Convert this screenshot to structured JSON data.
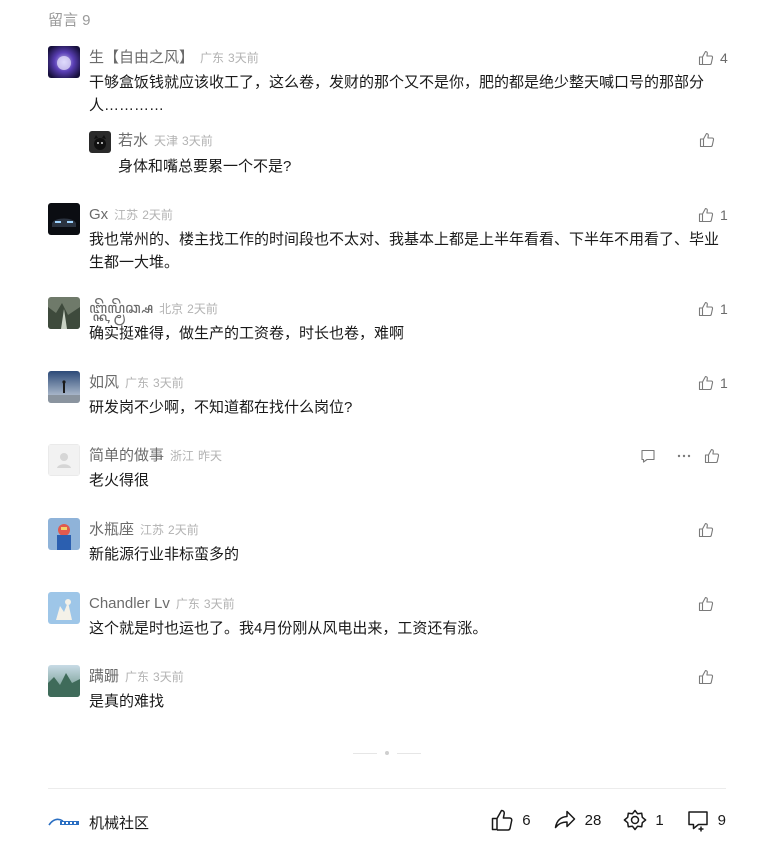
{
  "header": {
    "title": "留言 9"
  },
  "comments": [
    {
      "nick": "生【自由之风】",
      "location": "广东",
      "time": "3天前",
      "likes": "4",
      "text": "干够盒饭钱就应该收工了，这么卷，发财的那个又不是你，肥的都是绝少整天喊口号的那部分人…………",
      "text_line2": ""
    },
    {
      "nick": "Gx",
      "location": "江苏",
      "time": "2天前",
      "likes": "1",
      "text": "我也常州的、楼主找工作的时间段也不太对、我基本上都是上半年看看、下半年不用看了、毕业生都一大堆。"
    },
    {
      "nick": "ꦧ꧀ꦏꦼꦭ꧀ꦩꦼꦕ꧀ꦱ",
      "location": "北京",
      "time": "2天前",
      "likes": "1",
      "text": "确实挺难得，做生产的工资卷，时长也卷，难啊"
    },
    {
      "nick": "如风",
      "location": "广东",
      "time": "3天前",
      "likes": "1",
      "text": "研发岗不少啊，不知道都在找什么岗位?"
    },
    {
      "nick": "简单的做事",
      "location": "浙江",
      "time": "昨天",
      "likes": "",
      "text": "老火得很"
    },
    {
      "nick": "水瓶座",
      "location": "江苏",
      "time": "2天前",
      "likes": "",
      "text": "新能源行业非标蛮多的"
    },
    {
      "nick": "Chandler Lv",
      "location": "广东",
      "time": "3天前",
      "likes": "",
      "text": "这个就是时也运也了。我4月份刚从风电出来，工资还有涨。"
    },
    {
      "nick": "蹒跚",
      "location": "广东",
      "time": "3天前",
      "likes": "",
      "text": "是真的难找"
    }
  ],
  "reply": {
    "nick": "若水",
    "location": "天津",
    "time": "3天前",
    "likes": "",
    "text": "身体和嘴总要累一个不是?"
  },
  "footer": {
    "brand": "机械社区",
    "like_count": "6",
    "share_count": "28",
    "wow_count": "1",
    "comment_count": "9"
  },
  "icons": [
    "thumb-up-icon",
    "comment-bubble-icon",
    "more-dots-icon",
    "share-arrow-icon",
    "wow-flower-icon",
    "comment-plus-icon"
  ]
}
